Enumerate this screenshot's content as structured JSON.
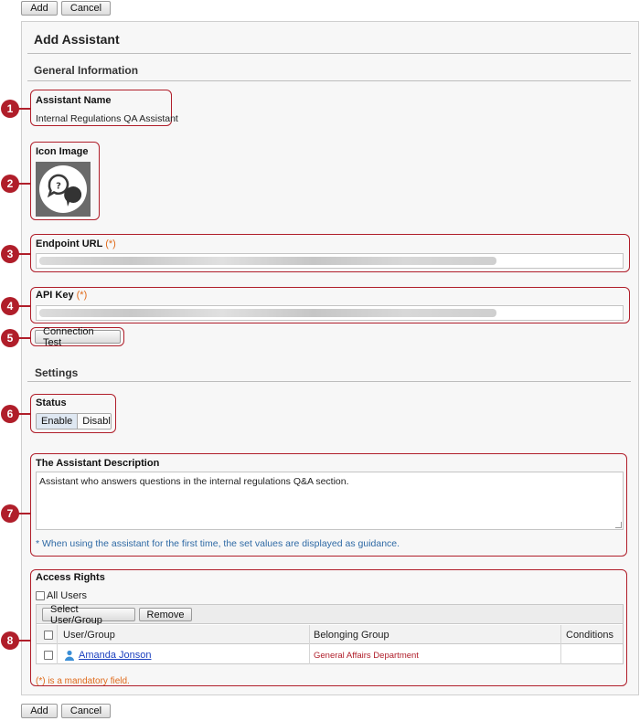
{
  "toolbar": {
    "add_label": "Add",
    "cancel_label": "Cancel"
  },
  "page": {
    "title": "Add Assistant"
  },
  "general": {
    "heading": "General Information",
    "assistant_name_label": "Assistant Name",
    "assistant_name_value": "Internal Regulations QA Assistant",
    "icon_image_label": "Icon Image",
    "icon_name": "question-speech-bubble-icon",
    "endpoint_label": "Endpoint URL",
    "api_key_label": "API Key",
    "required_mark": "(*)",
    "connection_test_label": "Connection Test"
  },
  "settings": {
    "heading": "Settings",
    "status_label": "Status",
    "status_options": [
      "Enable",
      "Disable"
    ],
    "status_selected": "Enable",
    "description_label": "The Assistant Description",
    "description_value": "Assistant who answers questions in the internal regulations Q&A section.",
    "description_note": "* When using the assistant for the first time, the set values are displayed as guidance."
  },
  "access": {
    "heading": "Access Rights",
    "all_users_label": "All Users",
    "select_button": "Select User/Group",
    "remove_button": "Remove",
    "columns": [
      "User/Group",
      "Belonging Group",
      "Conditions"
    ],
    "rows": [
      {
        "user": "Amanda Jonson",
        "group": "General Affairs Department",
        "conditions": ""
      }
    ],
    "mandatory_note": "(*) is a mandatory field."
  },
  "callouts": [
    "1",
    "2",
    "3",
    "4",
    "5",
    "6",
    "7",
    "8"
  ],
  "colors": {
    "callout": "#b01e2a",
    "accent": "#2f6aa5",
    "required": "#e06a1a",
    "link": "#1a3fbf"
  }
}
